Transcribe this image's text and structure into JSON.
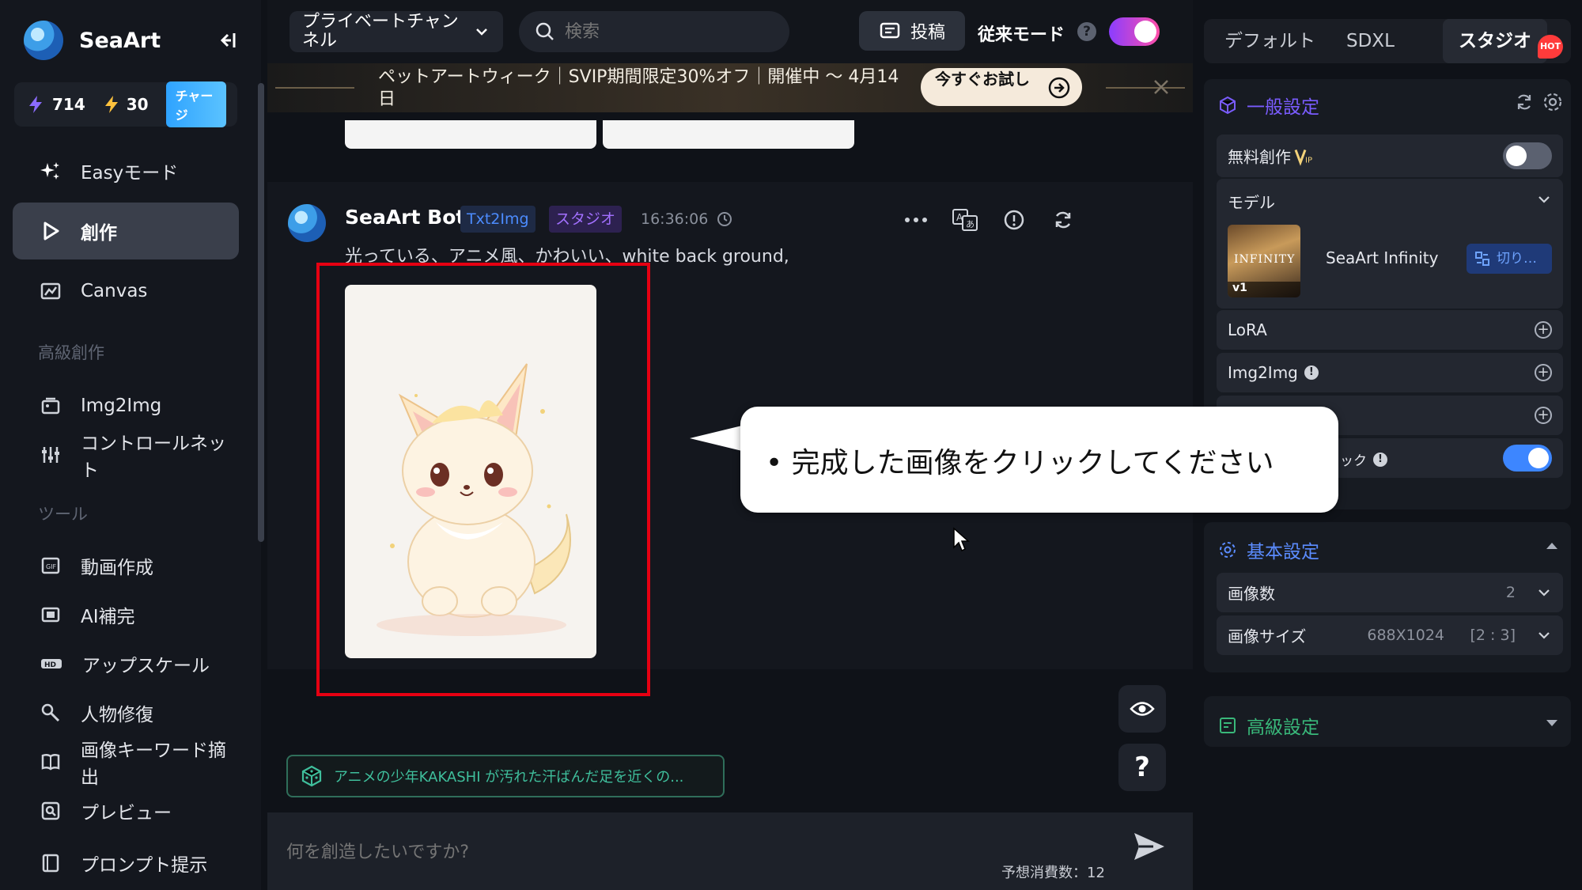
{
  "sidebar": {
    "brand": "SeaArt",
    "credits": {
      "a": "714",
      "b": "30",
      "charge_label": "チャージ"
    },
    "items": [
      {
        "label": "Easyモード"
      },
      {
        "label": "創作"
      },
      {
        "label": "Canvas"
      }
    ],
    "section_advanced": "高級創作",
    "advanced_items": [
      {
        "label": "Img2Img"
      },
      {
        "label": "コントロールネット"
      }
    ],
    "section_tools": "ツール",
    "tool_items": [
      {
        "label": "動画作成"
      },
      {
        "label": "AI補完"
      },
      {
        "label": "アップスケール"
      },
      {
        "label": "人物修復"
      },
      {
        "label": "画像キーワード摘出"
      },
      {
        "label": "プレビュー"
      },
      {
        "label": "プロンプト提示"
      }
    ]
  },
  "topbar": {
    "channel": "プライベートチャンネル",
    "search_label": "検索",
    "post_label": "投稿",
    "legacy_mode": "従来モード",
    "help": "?"
  },
  "banner": {
    "text": "ペットアートウィーク｜SVIP期間限定30%オフ｜開催中 ～ 4月14日",
    "cta": "今すぐお試し"
  },
  "message": {
    "bot_name": "SeaArt Bot",
    "tag_1": "Txt2Img",
    "tag_2": "スタジオ",
    "time": "16:36:06",
    "prompt": "光っている、アニメ風、かわいい、white back ground,"
  },
  "suggestion": "アニメの少年KAKASHI が汚れた汗ばんだ足を近くの...",
  "help_button": "?",
  "composer": {
    "placeholder": "何を創造したいですか?",
    "cost": "予想消費数：12"
  },
  "right": {
    "tabs": [
      "デフォルト",
      "SDXL",
      "スタジオ"
    ],
    "hot": "HOT",
    "general_title": "一般設定",
    "free_create": "無料創作",
    "model_label": "モデル",
    "model_thumb_title": "INFINITY",
    "model_thumb_ver": "v1",
    "model_name": "SeaArt Infinity",
    "switch_label": "切り…",
    "lora": "LoRA",
    "img2img": "Img2Img",
    "hidden_row_suffix": "ック",
    "basic_title": "基本設定",
    "image_count_label": "画像数",
    "image_count_value": "2",
    "image_size_label": "画像サイズ",
    "image_size_value": "688X1024",
    "image_size_ratio": "[2 : 3]",
    "advanced_title": "高級設定"
  },
  "callout": {
    "text": "• 完成した画像をクリックしてください"
  }
}
